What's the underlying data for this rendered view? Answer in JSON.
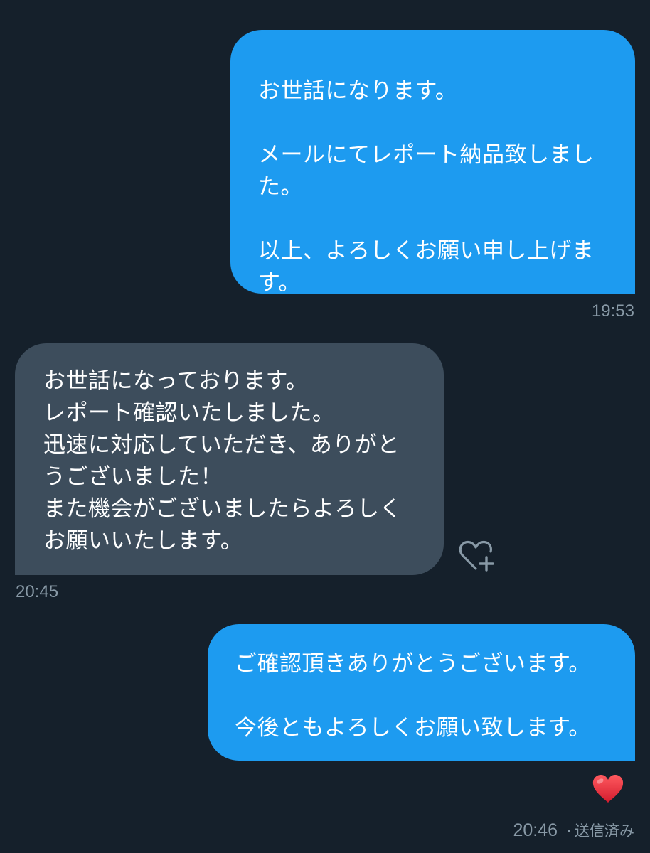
{
  "conversation": {
    "messages": [
      {
        "direction": "sent",
        "text": "お世話になります。\n\nメールにてレポート納品致しまし\nた。\n\n以上、よろしくお願い申し上げま\nす。",
        "time": "19:53"
      },
      {
        "direction": "received",
        "text": "お世話になっております。\nレポート確認いたしました。\n迅速に対応していただき、ありがと\nうございました！\nまた機会がございましたらよろしく\nお願いいたします。",
        "time": "20:45",
        "reaction_button_icon": "heart-plus-icon"
      },
      {
        "direction": "sent",
        "text": "ご確認頂きありがとうございます。\n\n今後ともよろしくお願い致します。",
        "time": "20:46",
        "separator": "·",
        "status": "送信済み",
        "reaction_icon": "red-heart-icon"
      }
    ]
  },
  "colors": {
    "background": "#15202b",
    "sent_bubble": "#1d9bf0",
    "received_bubble": "#3d4d5c",
    "timestamp": "#8899a6",
    "reaction_heart": "#e0245e"
  }
}
